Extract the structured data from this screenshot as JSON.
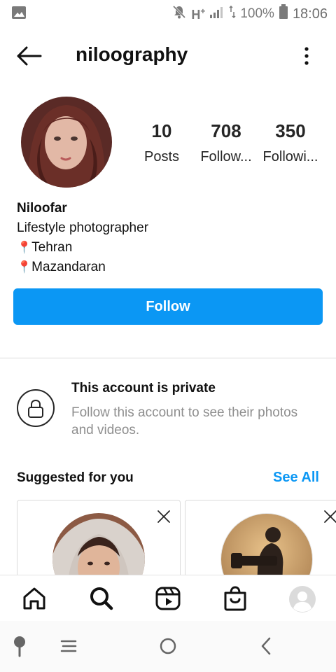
{
  "status_bar": {
    "network": "H",
    "network_sup": "+",
    "battery": "100%",
    "time": "18:06",
    "icons": [
      "image-icon",
      "mute-icon",
      "signal-icon",
      "battery-icon"
    ]
  },
  "header": {
    "username": "niloography",
    "icons": [
      "back-arrow-icon",
      "more-options-icon"
    ]
  },
  "profile": {
    "stats": [
      {
        "value": "10",
        "label": "Posts"
      },
      {
        "value": "708",
        "label": "Follow..."
      },
      {
        "value": "350",
        "label": "Followi..."
      }
    ],
    "name": "Niloofar",
    "bio_lines": [
      "Lifestyle photographer"
    ],
    "locations": [
      "Tehran",
      "Mazandaran"
    ],
    "pin_glyph": "📍"
  },
  "follow_button": {
    "label": "Follow",
    "color": "#0b97f4"
  },
  "private": {
    "title": "This account is private",
    "description": "Follow this account to see their photos and videos."
  },
  "suggested": {
    "title": "Suggested for you",
    "see_all": "See All"
  },
  "bottom_nav": {
    "items": [
      "home-icon",
      "search-icon",
      "reels-icon",
      "shop-icon",
      "profile-avatar"
    ]
  },
  "system_nav": {
    "items": [
      "assistant-icon",
      "menu-icon",
      "home-circle-icon",
      "back-chevron-icon"
    ]
  }
}
